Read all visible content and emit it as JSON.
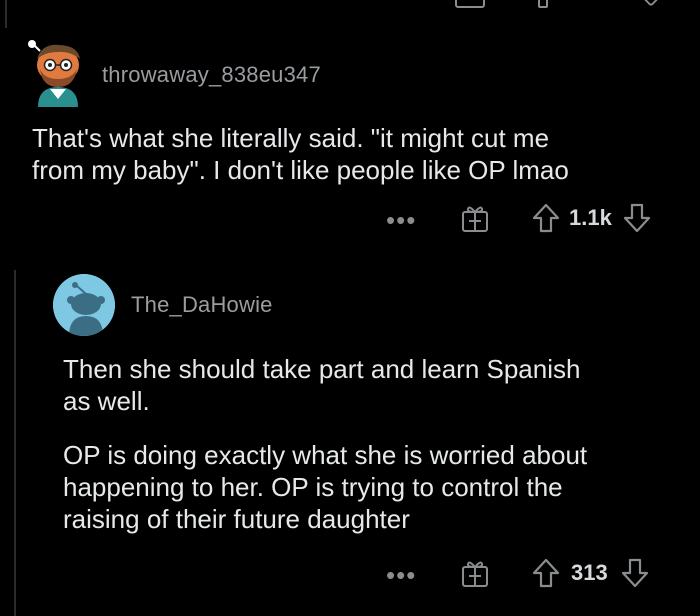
{
  "comments": [
    {
      "username": "throwaway_838eu347",
      "body": [
        "That's what she literally said. \"it might cut me",
        "from my baby\". I don't like people like OP lmao"
      ],
      "score": "1.1k",
      "more_label": "•••"
    },
    {
      "username": "The_DaHowie",
      "body_paragraphs": [
        [
          "Then she should take part and learn Spanish",
          "as well."
        ],
        [
          "OP is doing exactly what she is worried about",
          "happening to her. OP is trying to control the",
          "raising of their future daughter"
        ]
      ],
      "score": "313",
      "more_label": "•••"
    }
  ],
  "icons": {
    "award": "gift-box-icon",
    "upvote": "arrow-up-icon",
    "downvote": "arrow-down-icon",
    "more": "more-dots-icon"
  },
  "colors": {
    "background": "#000000",
    "username": "#9a9da0",
    "text": "#e6e8ea",
    "icon": "#8a8d90",
    "avatar2_bg": "#7ec8e3"
  }
}
